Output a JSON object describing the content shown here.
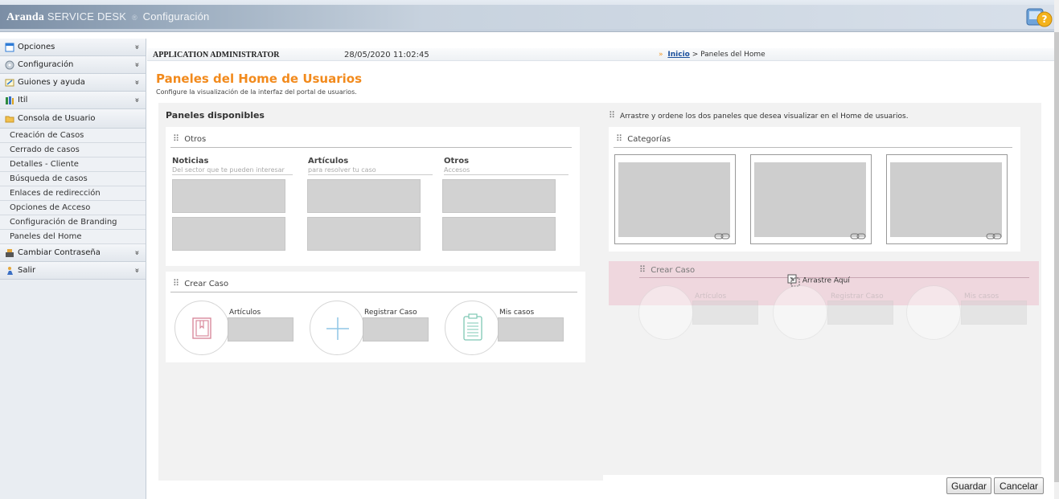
{
  "header": {
    "brand": "Aranda",
    "product": "SERVICE DESK",
    "reg": "®",
    "section": "Configuración"
  },
  "sidebar": {
    "groups": [
      {
        "label": "Opciones",
        "icon": "window-icon"
      },
      {
        "label": "Configuración",
        "icon": "disk-icon"
      },
      {
        "label": "Guiones y ayuda",
        "icon": "script-icon"
      },
      {
        "label": "Itil",
        "icon": "books-icon"
      }
    ],
    "console": {
      "label": "Consola de Usuario",
      "icon": "folder-icon"
    },
    "items": [
      "Creación de Casos",
      "Cerrado de casos",
      "Detalles - Cliente",
      "Búsqueda de casos",
      "Enlaces de redirección",
      "Opciones de Acceso",
      "Configuración de Branding",
      "Paneles del Home"
    ],
    "bottom": [
      {
        "label": "Cambiar Contraseña",
        "icon": "keyboard-icon"
      },
      {
        "label": "Salir",
        "icon": "exit-icon"
      }
    ],
    "chevron": "»"
  },
  "info": {
    "user": "APPLICATION ADMINISTRATOR",
    "datetime": "28/05/2020 11:02:45",
    "crumb_arrow": "»",
    "crumb_link": "Inicio",
    "crumb_rest": "> Paneles del Home"
  },
  "page": {
    "title": "Paneles del Home de Usuarios",
    "subtitle": "Configure la visualización de la interfaz del portal de usuarios."
  },
  "available": {
    "title": "Paneles disponibles",
    "otros": {
      "head": "Otros",
      "columns": [
        {
          "title": "Noticias",
          "sub": "Del sector que te pueden interesar"
        },
        {
          "title": "Artículos",
          "sub": "para resolver tu caso"
        },
        {
          "title": "Otros",
          "sub": "Accesos"
        }
      ]
    },
    "crear": {
      "head": "Crear Caso",
      "items": [
        "Artículos",
        "Registrar Caso",
        "Mis casos"
      ]
    }
  },
  "arranged": {
    "instruction": "Arrastre y ordene los dos paneles que desea visualizar en el Home de usuarios.",
    "categorias": {
      "head": "Categorías"
    },
    "drag": {
      "head": "Crear Caso",
      "drop_label": "Arrastre Aquí",
      "items": [
        "Artículos",
        "Registrar Caso",
        "Mis casos"
      ]
    }
  },
  "actions": {
    "save": "Guardar",
    "cancel": "Cancelar"
  },
  "colors": {
    "accent": "#f28a1c",
    "link": "#1a4f9c",
    "drop": "#ecc4d1"
  }
}
